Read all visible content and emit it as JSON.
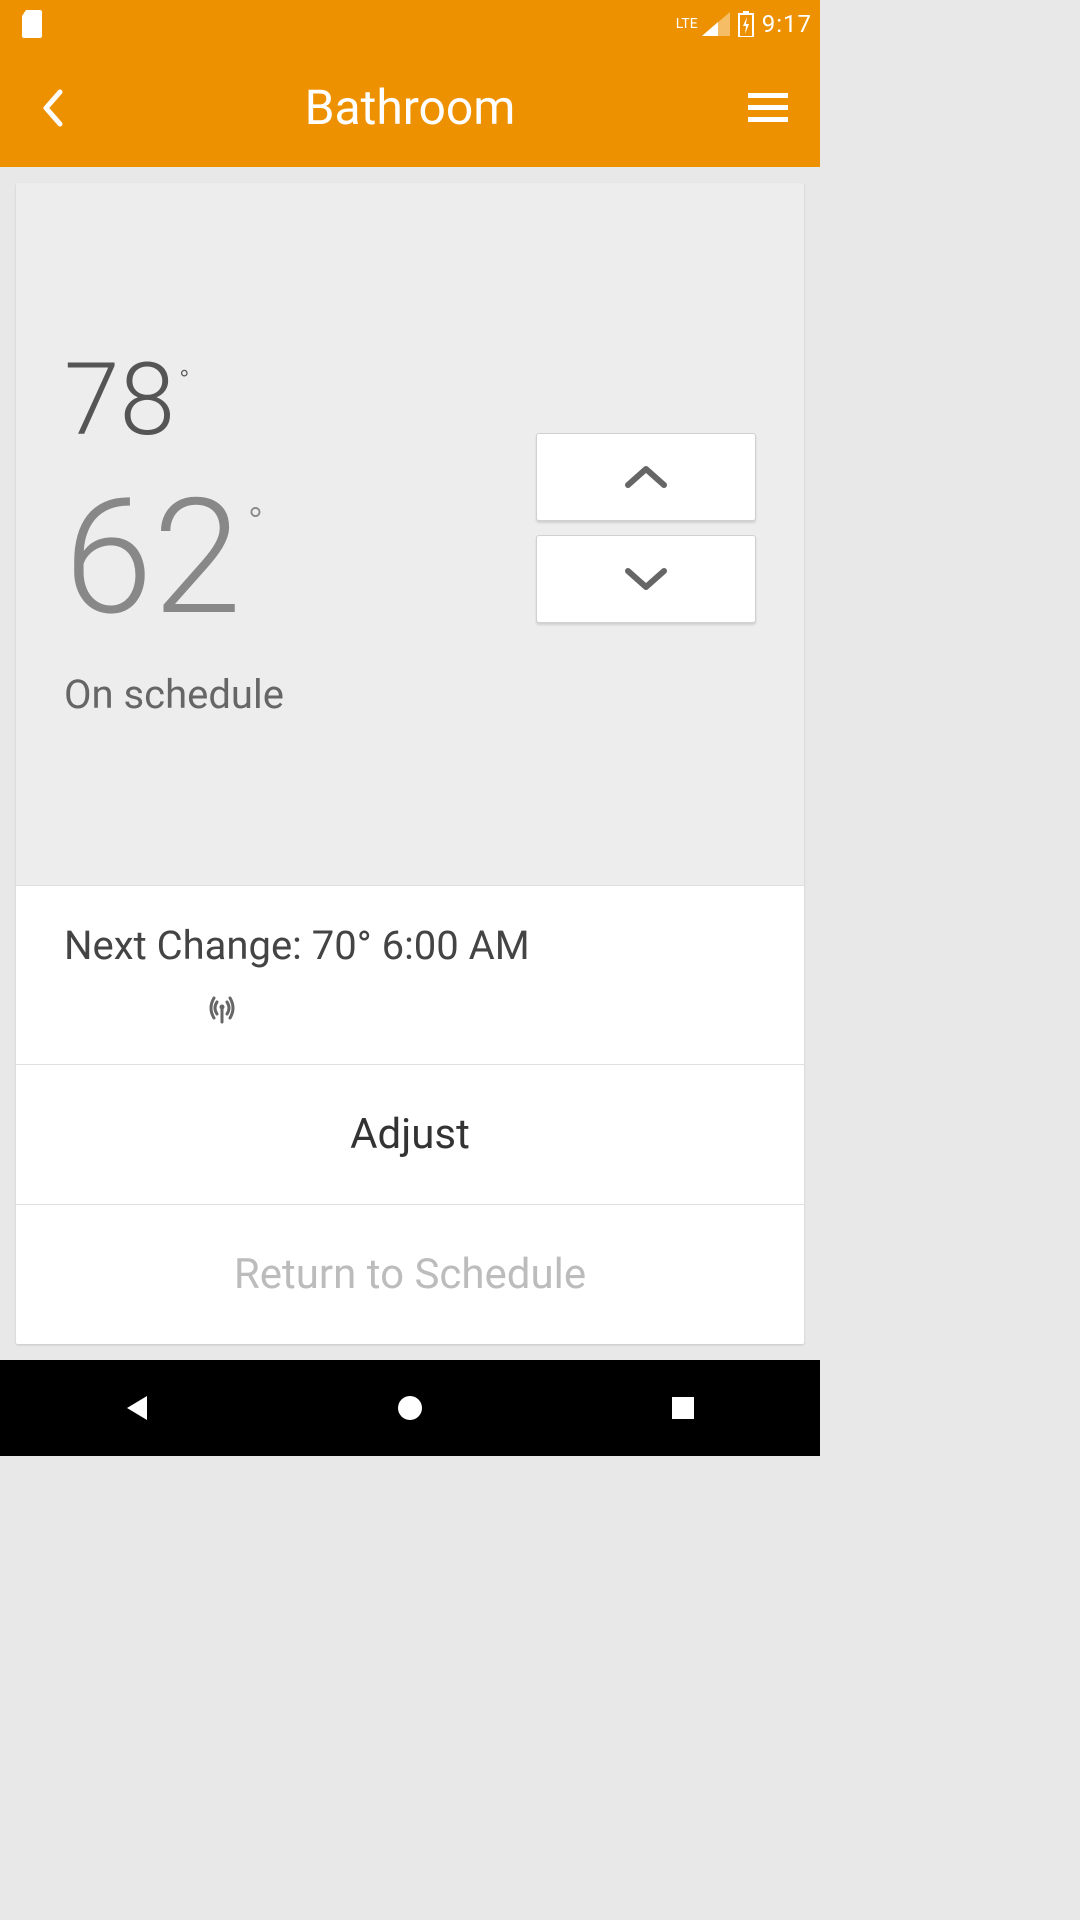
{
  "status": {
    "time": "9:17",
    "network": "LTE"
  },
  "header": {
    "title": "Bathroom"
  },
  "thermostat": {
    "ambient_temp": "78",
    "setpoint_temp": "62",
    "degree": "°",
    "status": "On schedule"
  },
  "next_change": {
    "text": "Next Change: 70° 6:00 AM"
  },
  "actions": {
    "adjust": "Adjust",
    "return": "Return to Schedule"
  }
}
